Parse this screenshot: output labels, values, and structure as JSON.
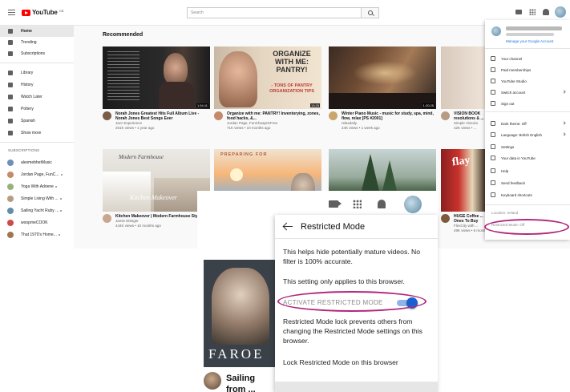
{
  "header": {
    "logo_text": "YouTube",
    "logo_sup": "GB",
    "search_placeholder": "Search"
  },
  "sidebar": {
    "items": [
      {
        "label": "Home",
        "active": true,
        "icon": "home-icon"
      },
      {
        "label": "Trending",
        "icon": "flame-icon"
      },
      {
        "label": "Subscriptions",
        "icon": "subscriptions-icon"
      },
      {
        "label": "Library",
        "icon": "library-icon"
      },
      {
        "label": "History",
        "icon": "history-icon"
      },
      {
        "label": "Watch Later",
        "icon": "clock-icon"
      },
      {
        "label": "Pottery",
        "icon": "playlist-icon"
      },
      {
        "label": "Spanish",
        "icon": "playlist-icon"
      },
      {
        "label": "Show more",
        "icon": "chevron-down-icon"
      }
    ],
    "subscriptions_heading": "SUBSCRIPTIONS",
    "subscriptions": [
      {
        "label": "alexmebhetMusic",
        "color": "#6d8fb8"
      },
      {
        "label": "Jordan Page, FunC...",
        "color": "#c58a6b"
      },
      {
        "label": "Yoga With Adriene",
        "color": "#9ab07c"
      },
      {
        "label": "Simple Living With ...",
        "color": "#b79c83"
      },
      {
        "label": "Sailing Yacht Ruby ...",
        "color": "#5f8fa8"
      },
      {
        "label": "woopmeCOOK",
        "color": "#d0494a"
      },
      {
        "label": "That 1970's Home...",
        "color": "#a07556"
      }
    ]
  },
  "main": {
    "section_title": "Recommended",
    "videos": [
      {
        "title": "Norah Jones Greatest Hits Full Album Live - Norah Jones Best Songs Ever",
        "channel": "Jazz Experience",
        "stats": "261K views • 1 year ago",
        "duration": "1:34:11"
      },
      {
        "title": "Organize with me: PANTRY! Inventorying, zones, food hacks, &...",
        "channel": "Jordan Page, FunCheapOrFree",
        "stats": "71K views • 10 months ago",
        "duration": "13:25",
        "thumb_text": "ORGANIZE WITH ME: PANTRY!",
        "thumb_sub": "- TONS OF PANTRY ORGANIZATION TIPS"
      },
      {
        "title": "Winter Piano Music - music for study, spa, mind, flow, relax [PS #2001]",
        "channel": "relaxdaily",
        "stats": "24K views • 1 week ago",
        "duration": "1:20:25"
      },
      {
        "title": "VISION BOOK resolutions & ...",
        "channel": "Simple Victoria",
        "stats": "42K views • ..."
      },
      {
        "title": "Kitchen Makeover | Modern Farmhouse Style",
        "channel": "Jamie Ettinger",
        "stats": "444K views • 10 months ago",
        "thumb_text": "Modern Farmhouse",
        "thumb_sub": "Kitchen Makeover"
      },
      {
        "title": "",
        "channel": "",
        "stats": "",
        "thumb_text": "PREPARING FOR"
      },
      {
        "title": "",
        "channel": "",
        "stats": ""
      },
      {
        "title": "",
        "channel": "",
        "stats": ""
      },
      {
        "title": "HUGE Coffee ... Ones To Buy",
        "channel": "FlexCity with ...",
        "stats": "49K views • 6 months ago"
      }
    ]
  },
  "account_menu": {
    "manage_label": "Manage your Google Account",
    "items": [
      {
        "label": "Your channel",
        "icon": "person-icon"
      },
      {
        "label": "Paid memberships",
        "icon": "dollar-icon"
      },
      {
        "label": "YouTube Studio",
        "icon": "gear-icon"
      },
      {
        "label": "Switch account",
        "icon": "switch-account-icon",
        "chevron": true
      },
      {
        "label": "Sign out",
        "icon": "sign-out-icon"
      },
      {
        "label": "Dark theme: Off",
        "icon": "moon-icon",
        "chevron": true
      },
      {
        "label": "Language: British English",
        "icon": "translate-icon",
        "chevron": true
      },
      {
        "label": "Settings",
        "icon": "gear-icon"
      },
      {
        "label": "Your data in YouTube",
        "icon": "shield-icon"
      },
      {
        "label": "Help",
        "icon": "help-icon"
      },
      {
        "label": "Send feedback",
        "icon": "feedback-icon"
      },
      {
        "label": "Keyboard shortcuts",
        "icon": "keyboard-icon"
      }
    ],
    "location": "Location: Ireland",
    "restricted": "Restricted Mode: Off"
  },
  "zoom_panel": {
    "video_overlay_text": "FAROE",
    "video_title": "Sailing from ... Islands",
    "restricted_mode": {
      "title": "Restricted Mode",
      "para1": "This helps hide potentially mature videos. No filter is 100% accurate.",
      "para2": "This setting only applies to this browser.",
      "toggle_label": "ACTIVATE RESTRICTED MODE",
      "toggle_on": true,
      "para3": "Restricted Mode lock prevents others from changing the Restricted Mode settings on this browser.",
      "para4": "Lock Restricted Mode on this browser"
    }
  },
  "colors": {
    "highlight_oval": "#b0267c",
    "toggle_blue": "#1a5fd0",
    "youtube_red": "#ff0000"
  }
}
